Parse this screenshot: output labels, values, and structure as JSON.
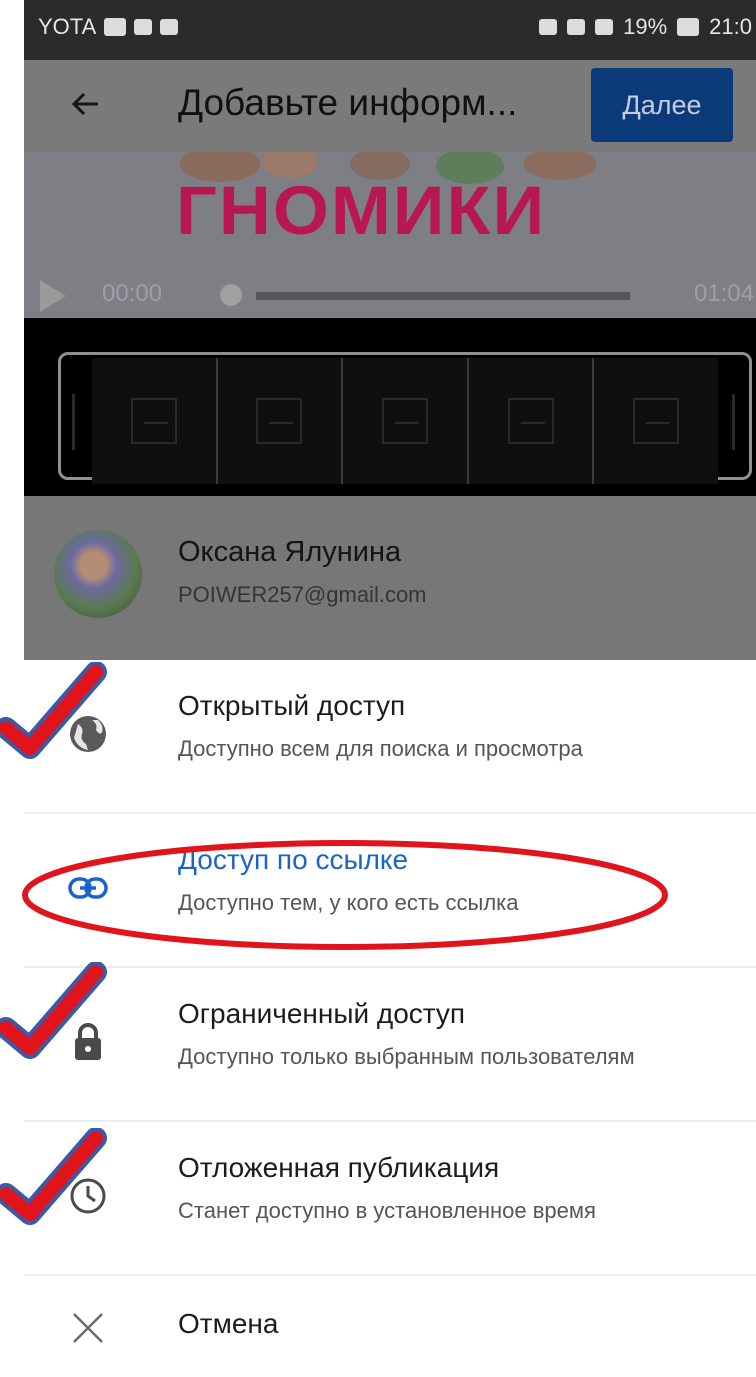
{
  "status_bar": {
    "carrier": "YOTA",
    "battery": "19%",
    "time": "21:0"
  },
  "appbar": {
    "title": "Добавьте информ...",
    "next_label": "Далее"
  },
  "video": {
    "thumbnail_text": "ГНОМИКИ",
    "time_start": "00:00",
    "time_end": "01:04"
  },
  "account": {
    "name": "Оксана Ялунина",
    "email": "POIWER257@gmail.com"
  },
  "options": [
    {
      "title": "Открытый доступ",
      "subtitle": "Доступно всем для поиска и просмотра",
      "icon": "globe-icon"
    },
    {
      "title": "Доступ по ссылке",
      "subtitle": "Доступно тем, у кого есть ссылка",
      "icon": "link-icon"
    },
    {
      "title": "Ограниченный доступ",
      "subtitle": "Доступно только выбранным пользователям",
      "icon": "lock-icon"
    },
    {
      "title": "Отложенная публикация",
      "subtitle": "Станет доступно в установленное время",
      "icon": "clock-icon"
    }
  ],
  "cancel": {
    "label": "Отмена",
    "icon": "close-icon"
  },
  "colors": {
    "accent_link": "#1b64c6",
    "button": "#0a3a7a",
    "annotation_red": "#e0141a",
    "annotation_blue": "#3a5aa8"
  }
}
